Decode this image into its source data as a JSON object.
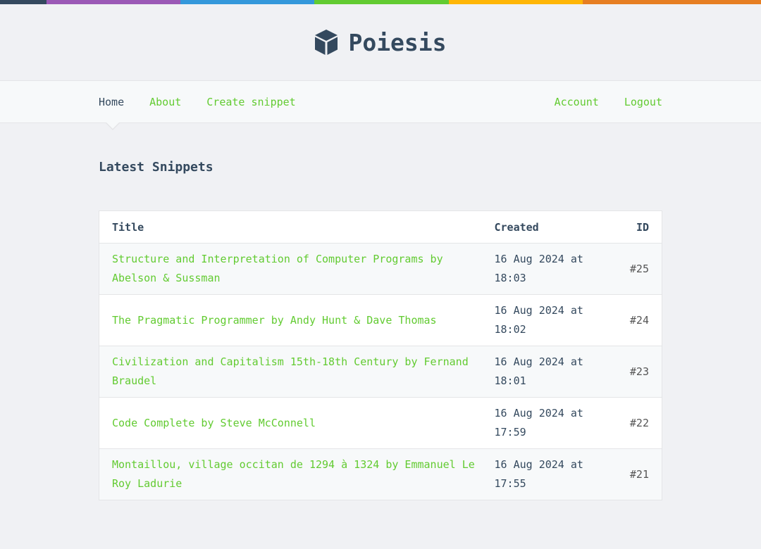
{
  "colors": {
    "bar": [
      "#34495e",
      "#9b59b6",
      "#3498db",
      "#62cb31",
      "#ffb606",
      "#e67e22"
    ],
    "accent": "#62cb31",
    "text": "#34495e"
  },
  "brand": {
    "name": "Poiesis",
    "icon": "cube-icon"
  },
  "nav": {
    "home": "Home",
    "about": "About",
    "create": "Create snippet",
    "account": "Account",
    "logout": "Logout"
  },
  "main": {
    "heading": "Latest Snippets",
    "columns": {
      "title": "Title",
      "created": "Created",
      "id": "ID"
    },
    "snippets": [
      {
        "title": "Structure and Interpretation of Computer Programs by Abelson & Sussman",
        "created": "16 Aug 2024 at 18:03",
        "id": "#25"
      },
      {
        "title": "The Pragmatic Programmer by Andy Hunt & Dave Thomas",
        "created": "16 Aug 2024 at 18:02",
        "id": "#24"
      },
      {
        "title": "Civilization and Capitalism 15th-18th Century by Fernand Braudel",
        "created": "16 Aug 2024 at 18:01",
        "id": "#23"
      },
      {
        "title": "Code Complete by Steve McConnell",
        "created": "16 Aug 2024 at 17:59",
        "id": "#22"
      },
      {
        "title": "Montaillou, village occitan de 1294 à 1324 by Emmanuel Le Roy Ladurie",
        "created": "16 Aug 2024 at 17:55",
        "id": "#21"
      }
    ]
  }
}
